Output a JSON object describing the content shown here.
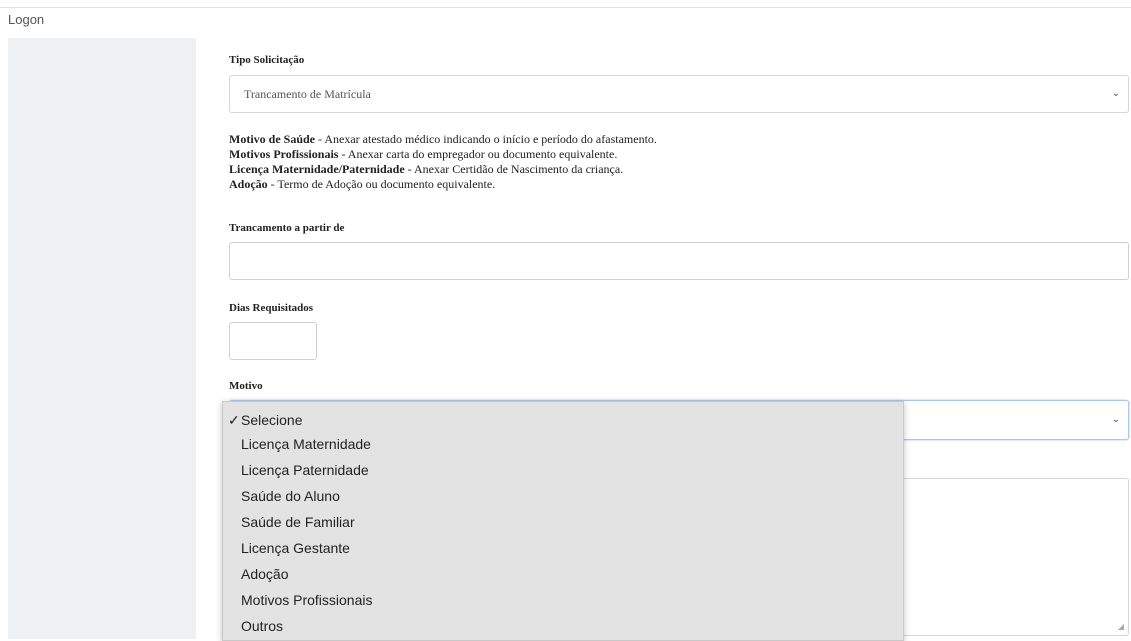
{
  "header": {
    "logon": "Logon"
  },
  "form": {
    "tipo": {
      "label": "Tipo Solicitação",
      "value": "Trancamento de Matrícula",
      "chevron": "chevron-down-icon"
    },
    "info": [
      {
        "bold": "Motivo de Saúde",
        "text": " - Anexar atestado médico indicando o início e período do afastamento."
      },
      {
        "bold": "Motivos Profissionais",
        "text": " - Anexar carta do empregador ou documento equivalente."
      },
      {
        "bold": "Licença Maternidade/Paternidade",
        "text": " - Anexar Certidão de Nascimento da criança."
      },
      {
        "bold": "Adoção",
        "text": " - Termo de Adoção ou documento equivalente."
      }
    ],
    "trancamento": {
      "label": "Trancamento a partir de",
      "value": ""
    },
    "dias": {
      "label": "Dias Requisitados",
      "value": ""
    },
    "motivo": {
      "label": "Motivo",
      "options": [
        {
          "label": "Selecione",
          "selected": true
        },
        {
          "label": "Licença Maternidade",
          "selected": false
        },
        {
          "label": "Licença Paternidade",
          "selected": false
        },
        {
          "label": "Saúde do Aluno",
          "selected": false
        },
        {
          "label": "Saúde de Familiar",
          "selected": false
        },
        {
          "label": "Licença Gestante",
          "selected": false
        },
        {
          "label": "Adoção",
          "selected": false
        },
        {
          "label": "Motivos Profissionais",
          "selected": false
        },
        {
          "label": "Outros",
          "selected": false
        }
      ]
    }
  },
  "colors": {
    "sidebar": "#eef0f2",
    "dropdown_bg": "#e3e3e3",
    "focus_border": "#aac7ee"
  }
}
